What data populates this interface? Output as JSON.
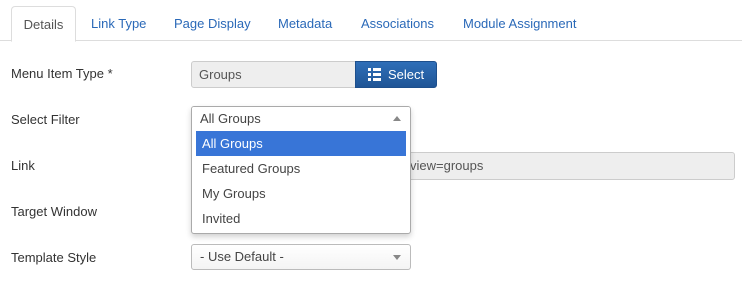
{
  "tabs": [
    {
      "label": "Details",
      "active": true
    },
    {
      "label": "Link Type"
    },
    {
      "label": "Page Display"
    },
    {
      "label": "Metadata"
    },
    {
      "label": "Associations"
    },
    {
      "label": "Module Assignment"
    }
  ],
  "form": {
    "menu_item_type": {
      "label": "Menu Item Type *",
      "value": "Groups",
      "button": "Select"
    },
    "select_filter": {
      "label": "Select Filter",
      "value": "All Groups",
      "options": [
        "All Groups",
        "Featured Groups",
        "My Groups",
        "Invited"
      ],
      "highlighted": "All Groups"
    },
    "link": {
      "label": "Link",
      "value_visible": "view=groups"
    },
    "target_window": {
      "label": "Target Window"
    },
    "template_style": {
      "label": "Template Style",
      "value": "- Use Default -"
    }
  },
  "colors": {
    "link_blue": "#2a69b8",
    "button_blue": "#2461a8",
    "highlight": "#3875d7"
  },
  "icons": {
    "select_button": "list-icon"
  }
}
